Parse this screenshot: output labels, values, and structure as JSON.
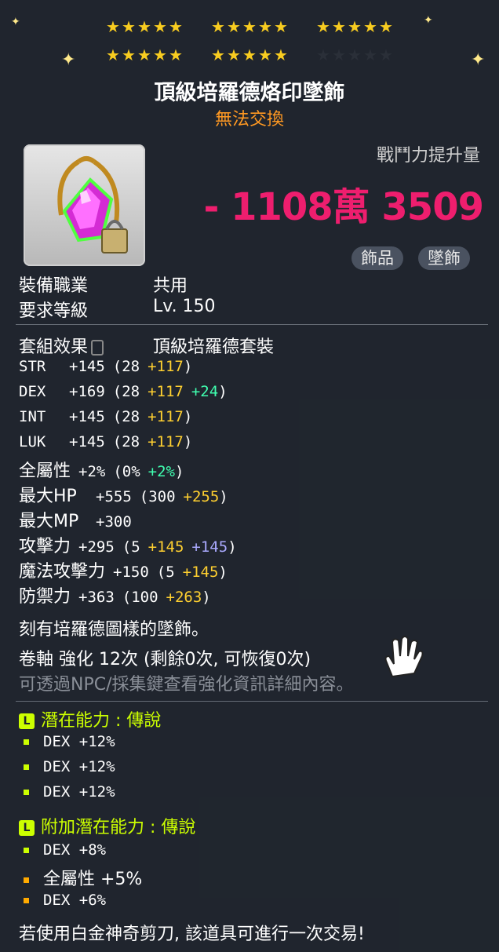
{
  "stars": {
    "row1": [
      1,
      1,
      1,
      1,
      1,
      1,
      1,
      1,
      1,
      1,
      1,
      1,
      1,
      1,
      1
    ],
    "row2": [
      1,
      1,
      1,
      1,
      1,
      1,
      1,
      1,
      1,
      1,
      0,
      0,
      0,
      0,
      0
    ]
  },
  "item": {
    "name": "頂級培羅德烙印墜飾",
    "trade": "無法交換",
    "icon": "pendant-icon"
  },
  "combat": {
    "label": "戰鬥力提升量",
    "value": "- 1108萬 3509"
  },
  "tags": [
    "飾品",
    "墜飾"
  ],
  "requirements": [
    {
      "label": "裝備職業",
      "value": "共用"
    },
    {
      "label": "要求等級",
      "value": "Lv. 150"
    }
  ],
  "set": {
    "label": "套組效果",
    "value": "頂級培羅德套裝"
  },
  "stats": [
    {
      "name": "STR",
      "total": "+145",
      "base": "(28",
      "parts": [
        {
          "t": "+117",
          "c": "y"
        }
      ],
      "close": ")"
    },
    {
      "name": "DEX",
      "total": "+169",
      "base": "(28",
      "parts": [
        {
          "t": "+117",
          "c": "y"
        },
        {
          "t": "+24",
          "c": "g"
        }
      ],
      "close": ")"
    },
    {
      "name": "INT",
      "total": "+145",
      "base": "(28",
      "parts": [
        {
          "t": "+117",
          "c": "y"
        }
      ],
      "close": ")"
    },
    {
      "name": "LUK",
      "total": "+145",
      "base": "(28",
      "parts": [
        {
          "t": "+117",
          "c": "y"
        }
      ],
      "close": ")"
    },
    {
      "name": "全屬性",
      "total": "+2%",
      "base": "(0%",
      "parts": [
        {
          "t": "+2%",
          "c": "g"
        }
      ],
      "close": ")"
    },
    {
      "name": "最大HP",
      "total": "+555",
      "base": "(300",
      "parts": [
        {
          "t": "+255",
          "c": "y"
        }
      ],
      "close": ")"
    },
    {
      "name": "最大MP",
      "total": "+300",
      "base": "",
      "parts": [],
      "close": ""
    },
    {
      "name": "攻擊力",
      "total": "+295",
      "base": "(5",
      "parts": [
        {
          "t": "+145",
          "c": "y"
        },
        {
          "t": "+145",
          "c": "p"
        }
      ],
      "close": ")"
    },
    {
      "name": "魔法攻擊力",
      "total": "+150",
      "base": "(5",
      "parts": [
        {
          "t": "+145",
          "c": "y"
        }
      ],
      "close": ")"
    },
    {
      "name": "防禦力",
      "total": "+363",
      "base": "(100",
      "parts": [
        {
          "t": "+263",
          "c": "y"
        }
      ],
      "close": ")"
    }
  ],
  "description": "刻有培羅德圖樣的墜飾。",
  "scroll": "卷軸 強化 12次 (剩餘0次, 可恢復0次)",
  "hint": "可透過NPC/採集鍵查看強化資訊詳細內容。",
  "potential": {
    "title": "潛在能力 : 傳說",
    "lines": [
      "DEX +12%",
      "DEX +12%",
      "DEX +12%"
    ]
  },
  "bonus": {
    "title": "附加潛在能力 : 傳說",
    "lines": [
      {
        "text": "DEX +8%",
        "mark": "green"
      },
      {
        "text": "全屬性 +5%",
        "mark": "orange"
      },
      {
        "text": "DEX +6%",
        "mark": "orange"
      }
    ]
  },
  "footer": "若使用白金神奇剪刀, 該道具可進行一次交易!",
  "colors": {
    "cp": "#ee1e6e",
    "star": "#f8cc20",
    "potential": "#ccff00",
    "trade": "#ff9922"
  }
}
